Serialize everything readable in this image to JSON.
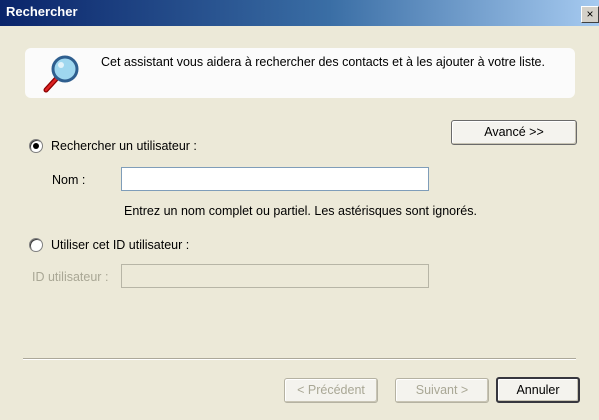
{
  "window": {
    "title": "Rechercher",
    "close_glyph": "×"
  },
  "intro": {
    "icon": "search-magnifier-icon",
    "text": "Cet assistant vous aidera à rechercher des contacts et à les ajouter à votre liste."
  },
  "advanced_button": "Avancé >>",
  "search_user": {
    "radio_label": "Rechercher un utilisateur :",
    "selected": true,
    "name_label": "Nom :",
    "name_value": "",
    "hint": "Entrez un nom complet ou partiel.  Les astérisques sont ignorés."
  },
  "use_id": {
    "radio_label": "Utiliser cet ID utilisateur :",
    "selected": false,
    "id_label": "ID utilisateur :",
    "id_value": ""
  },
  "footer": {
    "prev": "< Précédent",
    "next": "Suivant >",
    "cancel": "Annuler"
  }
}
